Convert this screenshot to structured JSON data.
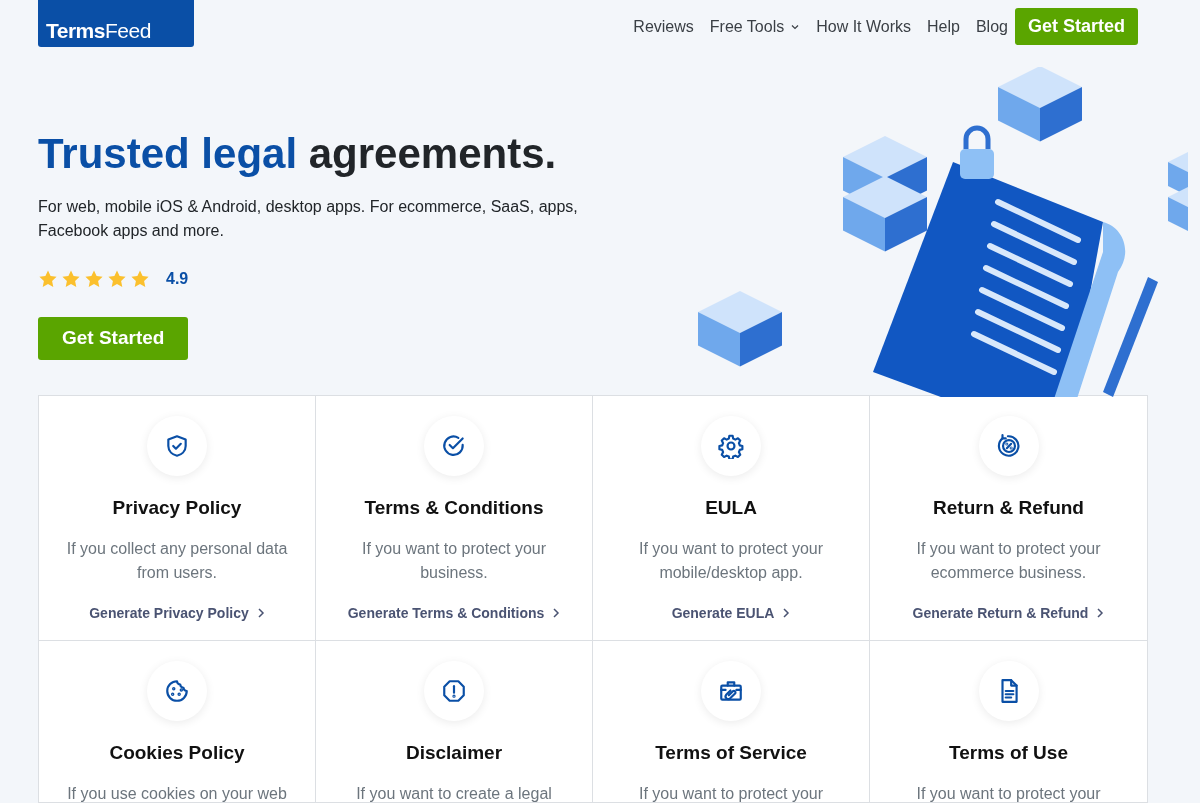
{
  "logo": {
    "bold": "Terms",
    "light": "Feed"
  },
  "nav": {
    "items": [
      {
        "label": "Reviews",
        "has_dropdown": false
      },
      {
        "label": "Free Tools",
        "has_dropdown": true
      },
      {
        "label": "How It Works",
        "has_dropdown": false
      },
      {
        "label": "Help",
        "has_dropdown": false
      },
      {
        "label": "Blog",
        "has_dropdown": false
      }
    ],
    "cta": "Get Started"
  },
  "hero": {
    "heading": [
      {
        "text": "Trusted legal",
        "highlight": true
      },
      {
        "text": "agreements.",
        "highlight": false
      }
    ],
    "subtitle": "For web, mobile iOS & Android, desktop apps. For ecommerce, SaaS, apps, Facebook apps and more.",
    "stars": 5,
    "rating": "4.9",
    "button": "Get Started"
  },
  "cards": [
    {
      "title": "Privacy Policy",
      "description": "If you collect any personal data from users.",
      "link": "Generate Privacy Policy"
    },
    {
      "title": "Terms & Conditions",
      "description": "If you want to protect your business.",
      "link": "Generate Terms & Conditions"
    },
    {
      "title": "EULA",
      "description": "If you want to protect your mobile/desktop app.",
      "link": "Generate EULA"
    },
    {
      "title": "Return & Refund",
      "description": "If you want to protect your ecommerce business.",
      "link": "Generate Return & Refund"
    },
    {
      "title": "Cookies Policy",
      "description": "If you use cookies on your web"
    },
    {
      "title": "Disclaimer",
      "description": "If you want to create a legal"
    },
    {
      "title": "Terms of Service",
      "description": "If you want to protect your"
    },
    {
      "title": "Terms of Use",
      "description": "If you want to protect your"
    }
  ]
}
